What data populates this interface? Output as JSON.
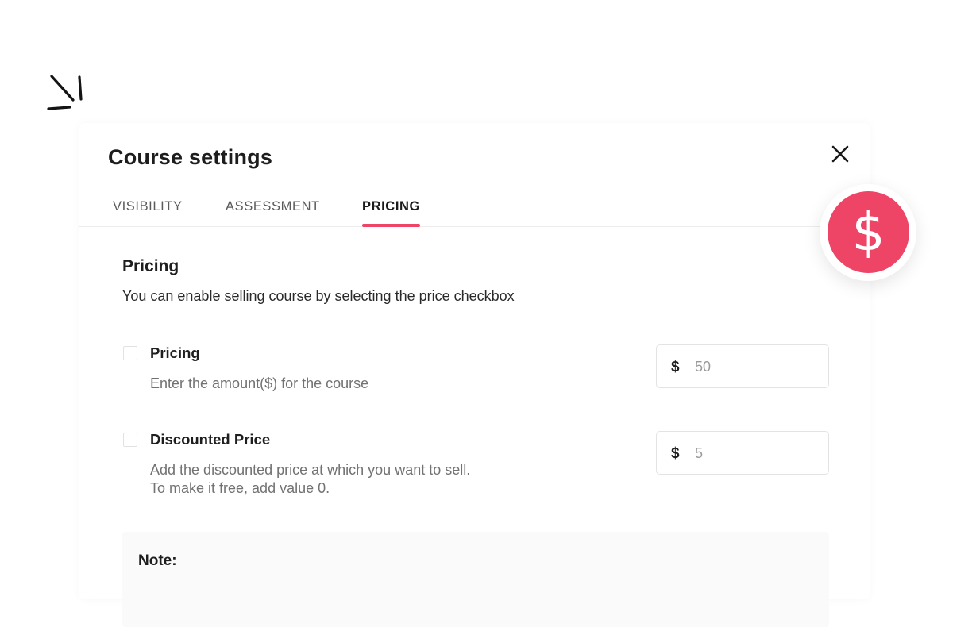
{
  "dialog": {
    "title": "Course settings"
  },
  "tabs": [
    {
      "label": "VISIBILITY",
      "active": false
    },
    {
      "label": "ASSESSMENT",
      "active": false
    },
    {
      "label": "PRICING",
      "active": true
    }
  ],
  "pricing_section": {
    "title": "Pricing",
    "description": "You can enable selling course by selecting the price checkbox",
    "options": [
      {
        "label": "Pricing",
        "description": [
          "Enter the amount($) for the course"
        ],
        "checked": false,
        "currency": "$",
        "placeholder": "50"
      },
      {
        "label": "Discounted Price",
        "description": [
          "Add the discounted price at which you want to sell.",
          "To make it free, add value 0."
        ],
        "checked": false,
        "currency": "$",
        "placeholder": "5"
      }
    ]
  },
  "note": {
    "title": "Note:"
  },
  "badge": {
    "symbol": "$",
    "icon": "dollar-icon",
    "color": "#ee4466"
  },
  "colors": {
    "accent": "#ee4466",
    "text": "#1e1e1e",
    "muted": "#727272"
  }
}
